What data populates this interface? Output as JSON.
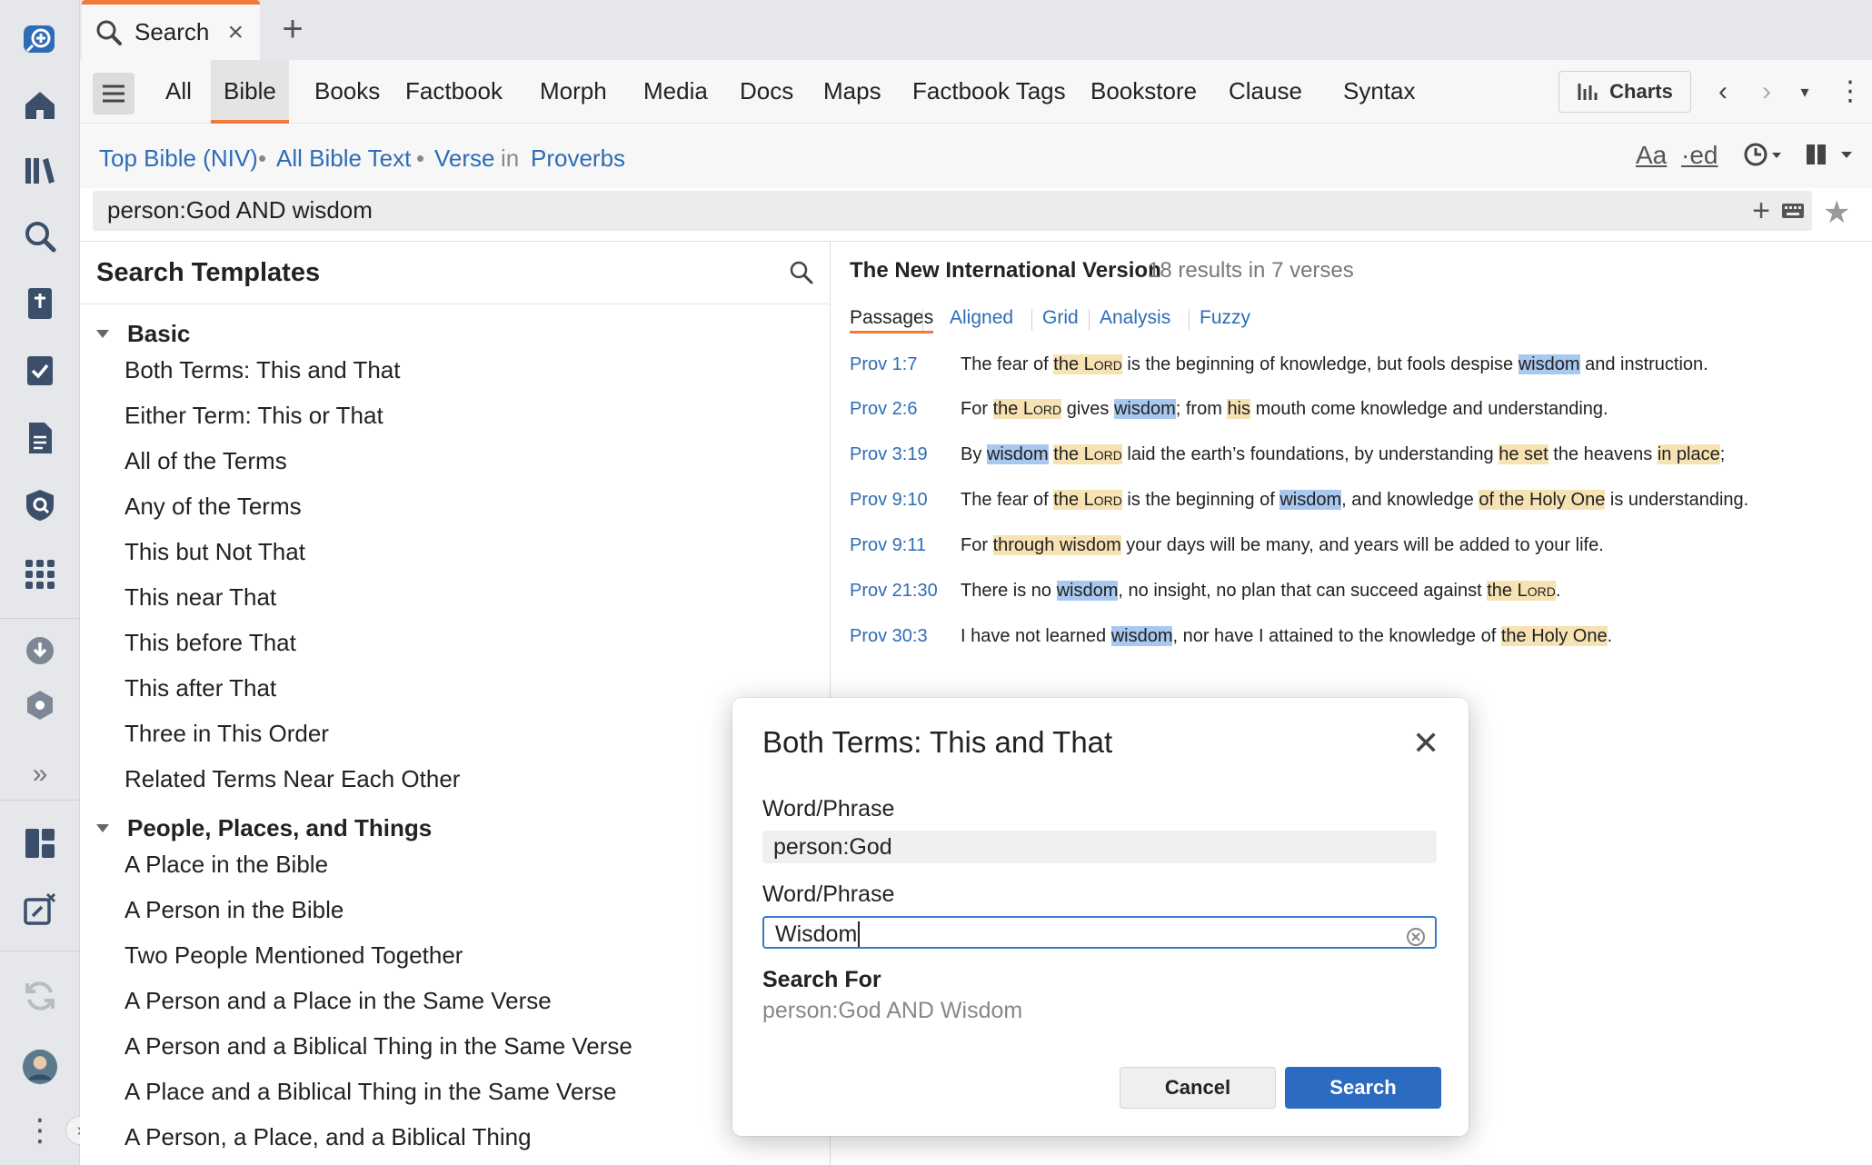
{
  "tab": {
    "label": "Search"
  },
  "nav_tabs": [
    "All",
    "Bible",
    "Books",
    "Factbook",
    "Morph",
    "Media",
    "Docs",
    "Maps",
    "Factbook Tags",
    "Bookstore",
    "Clause",
    "Syntax"
  ],
  "charts_label": "Charts",
  "scope": {
    "bible": "Top Bible (NIV)",
    "text": "All Bible Text",
    "unit": "Verse",
    "in_word": "in",
    "book": "Proverbs"
  },
  "tools": {
    "font": "Aa",
    "ed": "·ed"
  },
  "query": "person:God AND wisdom",
  "templates": {
    "title": "Search Templates",
    "groups": [
      {
        "label": "Basic",
        "items": [
          "Both Terms: This and That",
          "Either Term: This or That",
          "All of the Terms",
          "Any of the Terms",
          "This but Not That",
          "This near That",
          "This before That",
          "This after That",
          "Three in This Order",
          "Related Terms Near Each Other"
        ]
      },
      {
        "label": "People, Places, and Things",
        "items": [
          "A Place in the Bible",
          "A Person in the Bible",
          "Two People Mentioned Together",
          "A Person and a Place in the Same Verse",
          "A Person and a Biblical Thing in the Same Verse",
          "A Place and a Biblical Thing in the Same Verse",
          "A Person, a Place, and a Biblical Thing"
        ]
      }
    ]
  },
  "results": {
    "title": "The New International Version",
    "count": "18 results in 7 verses",
    "tabs": [
      "Passages",
      "Aligned",
      "Grid",
      "Analysis",
      "Fuzzy"
    ],
    "verses": [
      {
        "ref": "Prov 1:7"
      },
      {
        "ref": "Prov 2:6"
      },
      {
        "ref": "Prov 3:19"
      },
      {
        "ref": "Prov 9:10"
      },
      {
        "ref": "Prov 9:11"
      },
      {
        "ref": "Prov 21:30"
      },
      {
        "ref": "Prov 30:3"
      }
    ]
  },
  "dialog": {
    "title": "Both Terms: This and That",
    "label1": "Word/Phrase",
    "value1": "person:God",
    "label2": "Word/Phrase",
    "value2": "Wisdom",
    "search_for_label": "Search For",
    "search_for_value": "person:God AND Wisdom",
    "cancel": "Cancel",
    "search": "Search"
  },
  "colors": {
    "accent_orange": "#ef7a3a",
    "link_blue": "#2e6cb5",
    "primary_button": "#2c6bc2",
    "highlight_term": "#a9c8ef",
    "highlight_entity": "#f7e2b3"
  }
}
